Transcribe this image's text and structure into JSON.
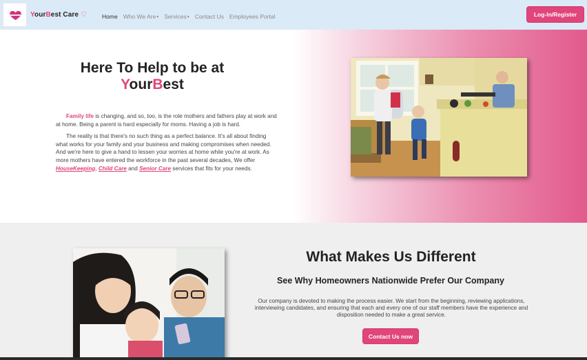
{
  "navbar": {
    "brand": {
      "part1": "Y",
      "part2": "our",
      "part3": "B",
      "part4": "est Care",
      "heart": "♡",
      "logo_icon": "heart-logo-icon"
    },
    "links": [
      {
        "label": "Home",
        "dropdown": false
      },
      {
        "label": "Who We Are",
        "dropdown": true
      },
      {
        "label": "Services",
        "dropdown": true
      },
      {
        "label": "Contact Us",
        "dropdown": false
      },
      {
        "label": "Employees Portal",
        "dropdown": false
      }
    ],
    "caret": "▾",
    "login_label": "Log-In/Register"
  },
  "hero": {
    "title_line1": "Here To Help to be at",
    "title_y": "Y",
    "title_our": "our",
    "title_b": "B",
    "title_est": "est",
    "p1_highlight": "Family life",
    "p1_rest": " is changing, and so, too, is the role mothers and fathers play at work and at home. Being a parent is hard especially for moms. Having a job is hard.",
    "p2_start": "The reality is that there's no such thing as a perfect balance. It's all about finding what works for your family and your business and making compromises when needed. And we're here to give a hand to lessen your worries at home while you're at work. As more mothers have entered the workforce in the past several decades, We offer ",
    "link_housekeeping": "HouseKeeping",
    "sep1": ", ",
    "link_childcare": "Child Care",
    "sep2": " and ",
    "link_seniorcare": "Senior Care",
    "p2_end": " services that fits for your needs."
  },
  "section2": {
    "title": "What Makes Us Different",
    "subtitle": "See Why Homeowners Nationwide Prefer Our Company",
    "text": "Our company is devoted to making the process easier. We start from the beginning, reviewing applications, interviewing candidates, and ensuring that each and every one of our staff members have the experience and disposition needed to make a great service.",
    "button_label": "Contact Us now"
  },
  "colors": {
    "accent": "#e0457b",
    "navbar_bg": "#dbeaf7",
    "section_bg": "#efefef"
  }
}
